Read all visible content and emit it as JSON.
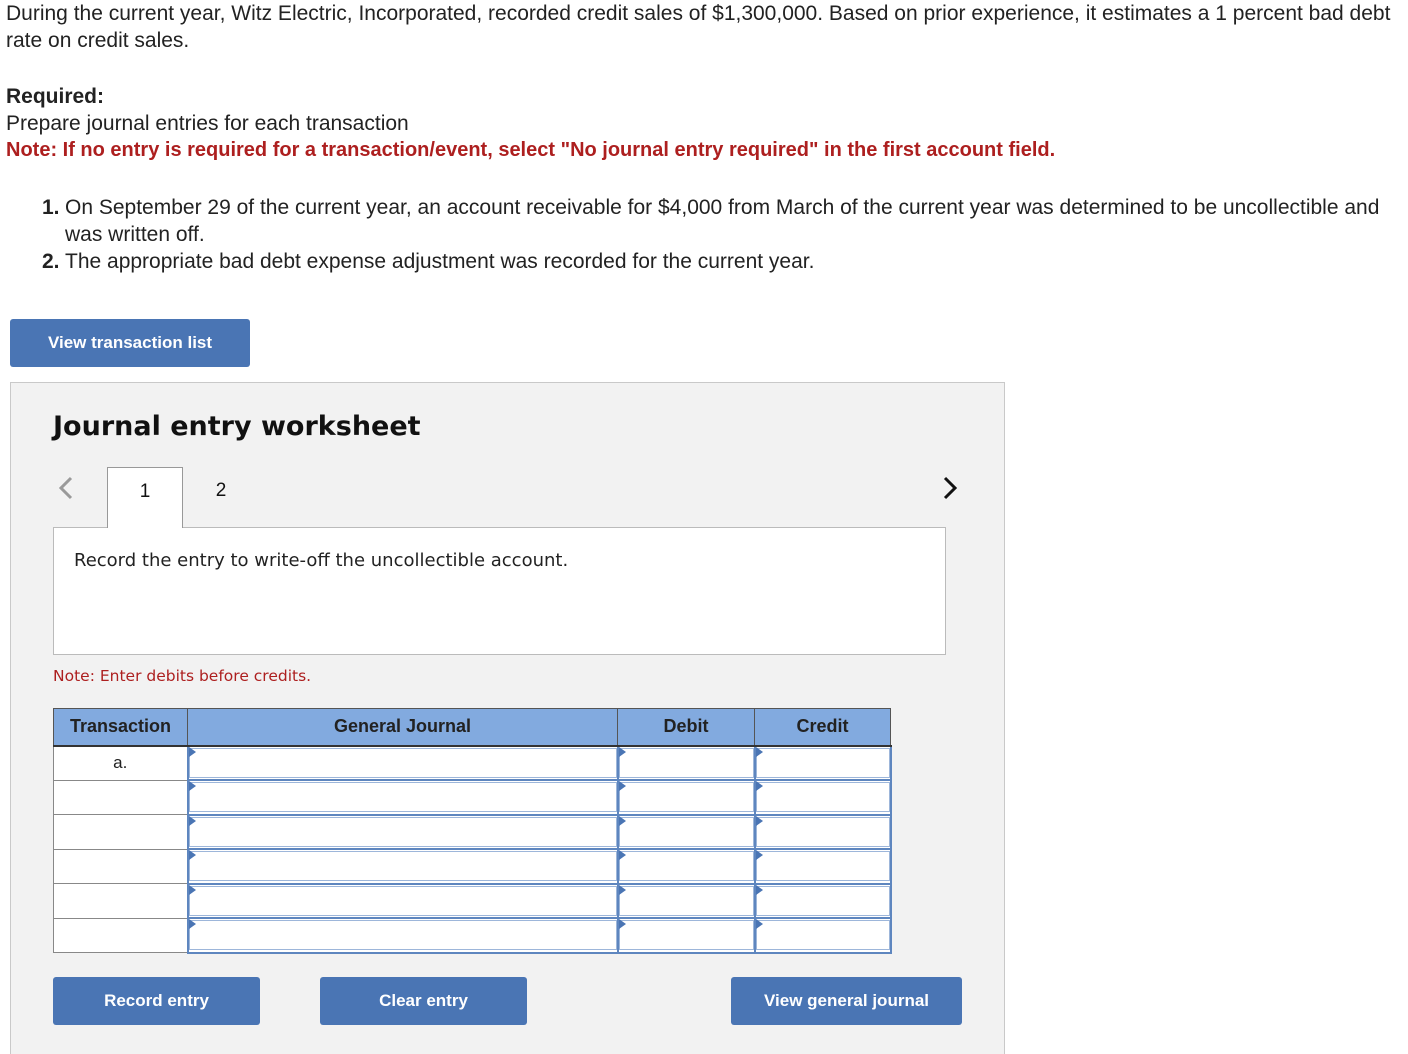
{
  "problem": {
    "intro": "During the current year, Witz Electric, Incorporated, recorded credit sales of $1,300,000. Based on prior experience, it estimates a 1 percent bad debt rate on credit sales.",
    "required_label": "Required:",
    "required_text": "Prepare journal entries for each transaction",
    "required_note": "Note: If no entry is required for a transaction/event, select \"No journal entry required\" in the first account field.",
    "transactions": [
      {
        "number": "1.",
        "text": "On September 29 of the current year, an account receivable for $4,000 from March of the current year was determined to be uncollectible and was written off."
      },
      {
        "number": "2.",
        "text": "The appropriate bad debt expense adjustment was recorded for the current year."
      }
    ]
  },
  "buttons": {
    "view_transaction_list": "View transaction list",
    "record_entry": "Record entry",
    "clear_entry": "Clear entry",
    "view_general_journal": "View general journal"
  },
  "worksheet": {
    "title": "Journal entry worksheet",
    "tabs": [
      {
        "label": "1",
        "active": true
      },
      {
        "label": "2",
        "active": false
      }
    ],
    "prompt": "Record the entry to write-off the uncollectible account.",
    "entry_note": "Note: Enter debits before credits.",
    "table": {
      "headers": [
        "Transaction",
        "General Journal",
        "Debit",
        "Credit"
      ],
      "rows": [
        {
          "transaction": "a.",
          "account": "",
          "debit": "",
          "credit": ""
        },
        {
          "transaction": "",
          "account": "",
          "debit": "",
          "credit": ""
        },
        {
          "transaction": "",
          "account": "",
          "debit": "",
          "credit": ""
        },
        {
          "transaction": "",
          "account": "",
          "debit": "",
          "credit": ""
        },
        {
          "transaction": "",
          "account": "",
          "debit": "",
          "credit": ""
        },
        {
          "transaction": "",
          "account": "",
          "debit": "",
          "credit": ""
        }
      ]
    }
  },
  "colors": {
    "button_blue": "#4a75b4",
    "header_blue": "#82aadf",
    "note_red": "#ad1f1f",
    "panel_gray": "#f2f2f2"
  }
}
